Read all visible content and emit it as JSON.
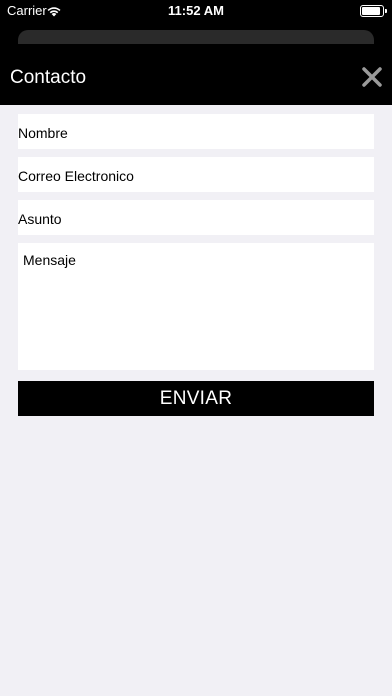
{
  "status_bar": {
    "carrier": "Carrier",
    "time": "11:52 AM",
    "battery_level": 1.0
  },
  "header": {
    "title": "Contacto",
    "close_icon": "close-icon"
  },
  "form": {
    "name_placeholder": "Nombre",
    "email_placeholder": "Correo Electronico",
    "subject_placeholder": "Asunto",
    "message_placeholder": "Mensaje",
    "submit_label": "ENVIAR"
  },
  "colors": {
    "header_bg": "#000000",
    "page_bg": "#f1f0f5",
    "button_bg": "#000000"
  }
}
